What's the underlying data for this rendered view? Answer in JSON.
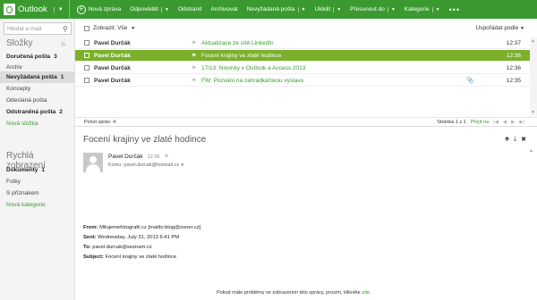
{
  "brand": {
    "name": "Outlook"
  },
  "toolbar": {
    "new_message": "Nová zpráva",
    "reply": "Odpovědět",
    "delete": "Odstranit",
    "archive": "Archivovat",
    "junk": "Nevyžádaná pošta",
    "sweep": "Uklidit",
    "move_to": "Přesunout do",
    "categories": "Kategorie",
    "more": "•••"
  },
  "sidebar": {
    "search_placeholder": "Hledat e-mail",
    "folders_title": "Složky",
    "folders": [
      {
        "label": "Doručená pošta",
        "count": "3"
      },
      {
        "label": "Archiv",
        "count": ""
      },
      {
        "label": "Nevyžádaná pošta",
        "count": "1"
      },
      {
        "label": "Koncepty",
        "count": ""
      },
      {
        "label": "Odeslaná pošta",
        "count": ""
      },
      {
        "label": "Odstraněná pošta",
        "count": "2"
      },
      {
        "label": "Nová složka",
        "count": ""
      }
    ],
    "quick_views_title": "Rychlá zobrazení",
    "quick_views": [
      {
        "label": "Dokumenty",
        "count": "1"
      },
      {
        "label": "Fotky",
        "count": ""
      },
      {
        "label": "S příznakem",
        "count": ""
      },
      {
        "label": "Nová kategorie",
        "count": ""
      }
    ]
  },
  "list": {
    "filter_label": "Zobrazit: Vše",
    "sort_label": "Uspořádat podle",
    "rows": [
      {
        "sender": "Pavel Durčák",
        "subject": "Aktualizace ze sítě LinkedIn",
        "time": "12:37",
        "attachment": false
      },
      {
        "sender": "Pavel Durčák",
        "subject": "Focení krajiny ve zlaté hodince",
        "time": "12:36",
        "attachment": false
      },
      {
        "sender": "Pavel Durčák",
        "subject": "17/13: Novinky v Outlook a Access 2013",
        "time": "12:36",
        "attachment": false
      },
      {
        "sender": "Pavel Durčák",
        "subject": "FW: Pozvání na zahrádkářskou výstavu",
        "time": "12:35",
        "attachment": true
      }
    ],
    "count_label": "Počet zpráv: 4",
    "page_label": "Stránka 1 z 1",
    "go_label": "Přejít na"
  },
  "reading": {
    "subject": "Focení krajiny ve zlaté hodince",
    "from_name": "Pavel Durčák",
    "time": "12:36",
    "to_line": "Komu: pavel.durcak@hotmail.cz",
    "header_from_label": "From:",
    "header_from": "Milujemefotografii.cz [mailto:blog@zoner.cz]",
    "header_sent_label": "Sent:",
    "header_sent": "Wednesday, July 31, 2013 6:41 PM",
    "header_to_label": "To:",
    "header_to": "pavel.durcak@seznam.cz",
    "header_subject_label": "Subject:",
    "header_subject": "Focení krajiny ve zlaté hodince",
    "footnote_text": "Pokud máte problémy se zobrazením této zprávy, prosím, klikněte",
    "footnote_link": "zde"
  },
  "colors": {
    "accent": "#3a9a2f",
    "selected_row": "#7ab02a"
  }
}
